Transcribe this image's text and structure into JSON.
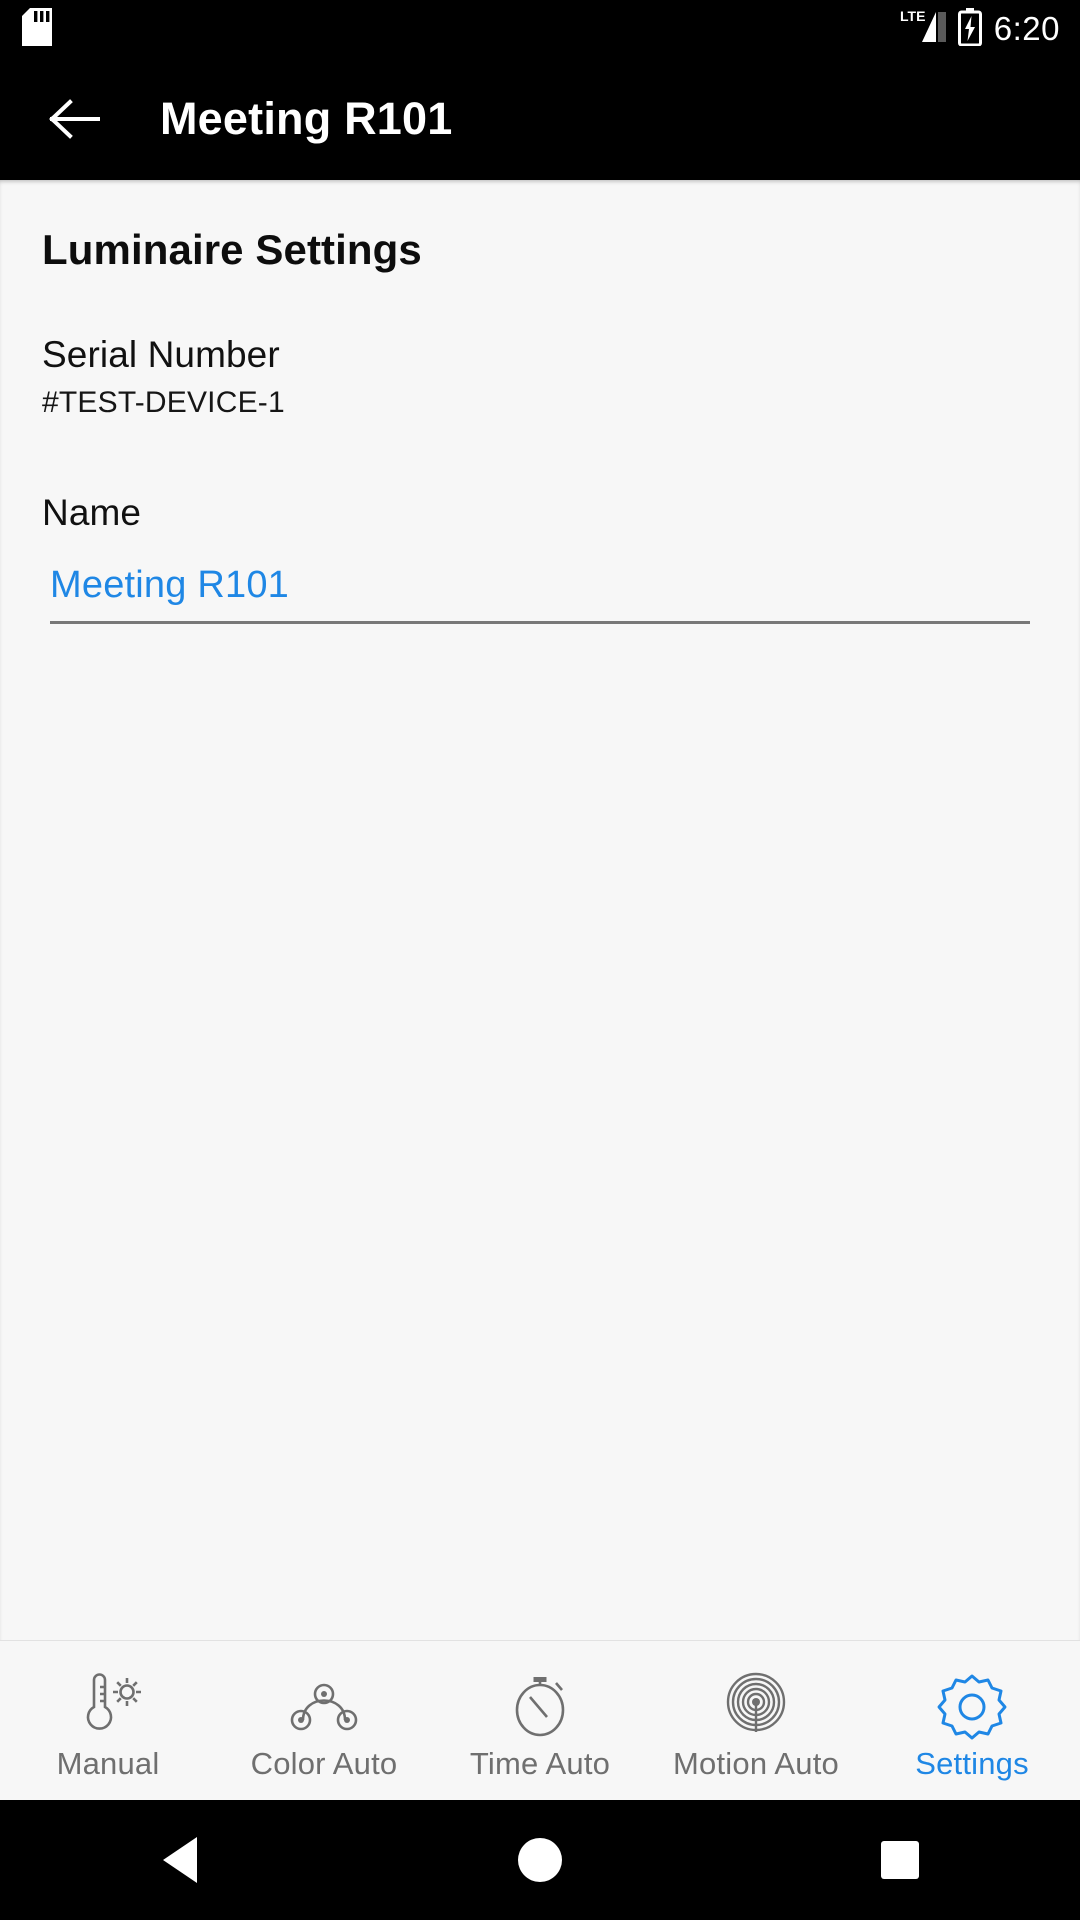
{
  "status_bar": {
    "sd_card_icon": "sd-card-icon",
    "network_label": "LTE",
    "signal_icon": "signal-bars-icon",
    "battery_icon": "battery-charging-icon",
    "time": "6:20"
  },
  "app_bar": {
    "back_icon": "back-arrow-icon",
    "title": "Meeting R101"
  },
  "main": {
    "section_title": "Luminaire Settings",
    "serial": {
      "label": "Serial Number",
      "value": "#TEST-DEVICE-1"
    },
    "name": {
      "label": "Name",
      "value": "Meeting R101",
      "placeholder": "Name"
    }
  },
  "tab_bar": {
    "active_color": "#1f87e5",
    "inactive_color": "#6f6f6f",
    "items": [
      {
        "label": "Manual",
        "icon": "thermometer-brightness-icon",
        "active": false
      },
      {
        "label": "Color Auto",
        "icon": "color-curve-icon",
        "active": false
      },
      {
        "label": "Time Auto",
        "icon": "stopwatch-icon",
        "active": false
      },
      {
        "label": "Motion Auto",
        "icon": "motion-sensor-icon",
        "active": false
      },
      {
        "label": "Settings",
        "icon": "gear-icon",
        "active": true
      }
    ]
  },
  "system_nav": {
    "back": "nav-back-icon",
    "home": "nav-home-icon",
    "recents": "nav-recents-icon"
  }
}
